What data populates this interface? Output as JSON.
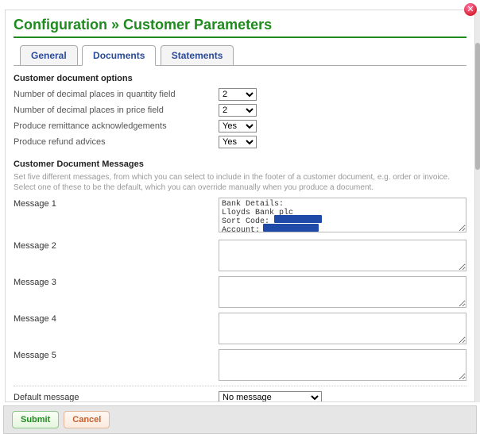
{
  "title": {
    "prefix": "Configuration",
    "sep": "»",
    "page": "Customer Parameters"
  },
  "tabs": {
    "general": "General",
    "documents": "Documents",
    "statements": "Statements"
  },
  "docopts": {
    "heading": "Customer document options",
    "qty_label": "Number of decimal places in quantity field",
    "qty_value": "2",
    "price_label": "Number of decimal places in price field",
    "price_value": "2",
    "remit_label": "Produce remittance acknowledgements",
    "remit_value": "Yes",
    "refund_label": "Produce refund advices",
    "refund_value": "Yes"
  },
  "messages": {
    "heading": "Customer Document Messages",
    "helper": "Set five different messages, from which you can select to include in the footer of a customer document, e.g. order or invoice. Select one of these to be the default, which you can override manually when you produce a document.",
    "m1_label": "Message 1",
    "m1_value": "Bank Details:\nLloyds Bank plc\nSort Code:\nAccount:",
    "m2_label": "Message 2",
    "m2_value": "",
    "m3_label": "Message 3",
    "m3_value": "",
    "m4_label": "Message 4",
    "m4_value": "",
    "m5_label": "Message 5",
    "m5_value": "",
    "default_label": "Default message",
    "default_value": "No message"
  },
  "buttons": {
    "submit": "Submit",
    "cancel": "Cancel"
  }
}
